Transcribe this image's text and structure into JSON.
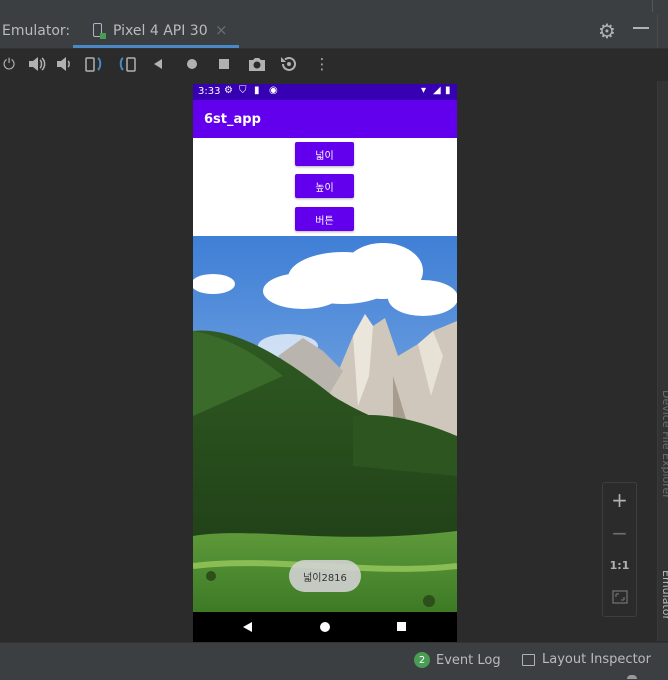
{
  "emulator_panel": {
    "label": "Emulator:",
    "tab": {
      "name": "Pixel 4 API 30",
      "close": "×"
    }
  },
  "toolbar": {
    "icons": [
      "power-icon",
      "volume-up-icon",
      "volume-down-icon",
      "rotate-left-icon",
      "rotate-right-icon",
      "back-icon",
      "home-icon",
      "overview-icon",
      "screenshot-icon",
      "snapshot-icon",
      "more-icon"
    ]
  },
  "device": {
    "status_bar": {
      "time": "3:33"
    },
    "app_title": "6st_app",
    "buttons": [
      {
        "label": "넓이"
      },
      {
        "label": "높이"
      },
      {
        "label": "버튼"
      }
    ],
    "toast": "넓이2816"
  },
  "zoom_controls": {
    "zoom_in": "+",
    "zoom_out": "−",
    "actual_size": "1:1"
  },
  "side_panels": {
    "device_file_explorer": "Device File Explorer",
    "emulator": "Emulator"
  },
  "bottom_bar": {
    "event_log": {
      "count": "2",
      "label": "Event Log"
    },
    "layout_inspector": {
      "label": "Layout Inspector"
    }
  },
  "colors": {
    "accent": "#6200ee",
    "status_bar": "#3700b3",
    "ide_tab_underline": "#4a88c7"
  }
}
